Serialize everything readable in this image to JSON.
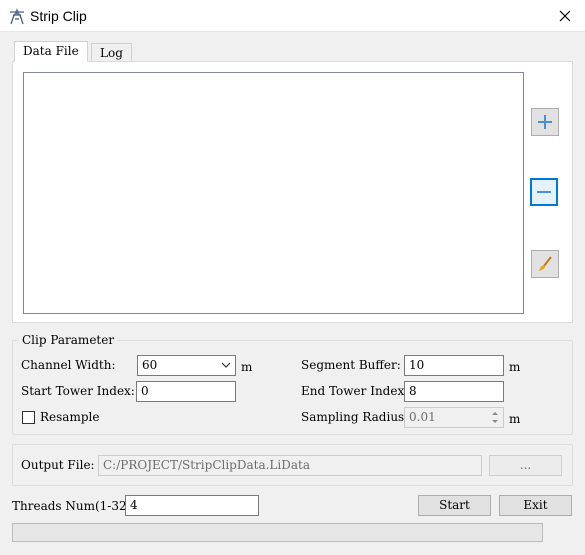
{
  "window": {
    "title": "Strip Clip",
    "close_icon": "close-icon",
    "app_icon": "strip-clip-app-icon"
  },
  "tabs": [
    {
      "label": "Data File",
      "active": true
    },
    {
      "label": "Log",
      "active": false
    }
  ],
  "data_file": {
    "files": [],
    "buttons": {
      "add_icon": "plus-icon",
      "remove_icon": "minus-icon",
      "clear_icon": "brush-icon"
    }
  },
  "clip_parameter": {
    "title": "Clip Parameter",
    "channel_width_label": "Channel Width:",
    "channel_width_value": "60",
    "channel_width_unit": "m",
    "segment_buffer_label": "Segment Buffer:",
    "segment_buffer_value": "10",
    "segment_buffer_unit": "m",
    "start_tower_label": "Start Tower Index:",
    "start_tower_value": "0",
    "end_tower_label": "End Tower Index:",
    "end_tower_value": "8",
    "resample_label": "Resample",
    "resample_checked": false,
    "sampling_radius_label": "Sampling Radius:",
    "sampling_radius_value": "0.01",
    "sampling_radius_unit": "m"
  },
  "output": {
    "label": "Output File:",
    "path": "C:/PROJECT/StripClipData.LiData",
    "browse_label": "..."
  },
  "threads": {
    "label": "Threads Num(1-32):",
    "value": "4"
  },
  "actions": {
    "start_label": "Start",
    "exit_label": "Exit"
  },
  "progress": {
    "value": 0
  },
  "colors": {
    "accent": "#0078d7",
    "plus_icon": "#4a90d9",
    "brush_icon": "#e8a317"
  }
}
